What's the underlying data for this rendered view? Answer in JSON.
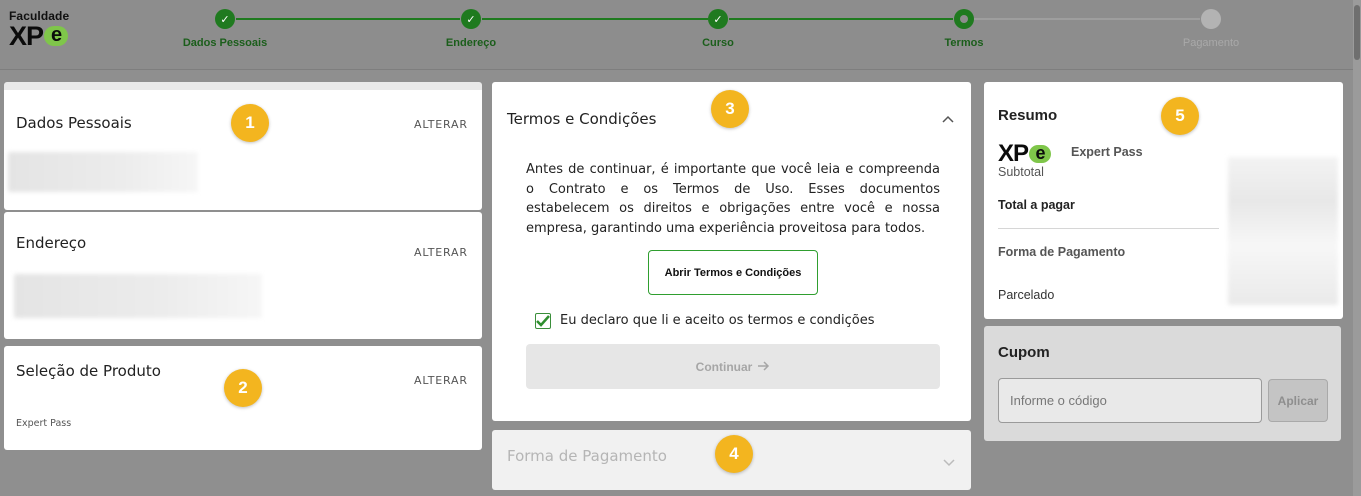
{
  "logo": {
    "faculty": "Faculdade",
    "brand": "XP",
    "brand_e": "e"
  },
  "steps": [
    {
      "label": "Dados Pessoais",
      "state": "done"
    },
    {
      "label": "Endereço",
      "state": "done"
    },
    {
      "label": "Curso",
      "state": "done"
    },
    {
      "label": "Termos",
      "state": "current"
    },
    {
      "label": "Pagamento",
      "state": "todo"
    }
  ],
  "left": {
    "personal": {
      "title": "Dados Pessoais",
      "action": "ALTERAR"
    },
    "address": {
      "title": "Endereço",
      "action": "ALTERAR"
    },
    "product": {
      "title": "Seleção de Produto",
      "action": "ALTERAR",
      "selected": "Expert Pass"
    }
  },
  "terms": {
    "title": "Termos e Condições",
    "body": "Antes de continuar, é importante que você leia e compreenda o Contrato e os Termos de Uso. Esses documentos estabelecem os direitos e obrigações entre você e nossa empresa, garantindo uma experiência proveitosa para todos.",
    "open_button": "Abrir Termos e Condições",
    "checkbox_label": "Eu declaro que li e aceito os termos e condições",
    "checkbox_checked": true,
    "continue_button": "Continuar"
  },
  "payment_section": {
    "title": "Forma de Pagamento"
  },
  "summary": {
    "title": "Resumo",
    "product_brand": "XP",
    "product_brand_e": "e",
    "product_name": "Expert Pass",
    "subtotal_label": "Subtotal",
    "total_label": "Total a pagar",
    "payment_label": "Forma de Pagamento",
    "installments_label": "Parcelado"
  },
  "coupon": {
    "title": "Cupom",
    "placeholder": "Informe o código",
    "button": "Aplicar"
  },
  "badges": [
    "1",
    "2",
    "3",
    "4",
    "5"
  ],
  "colors": {
    "accent_green": "#1f7a1f",
    "badge": "#f3b51f",
    "brand_green": "#7fc64a"
  }
}
